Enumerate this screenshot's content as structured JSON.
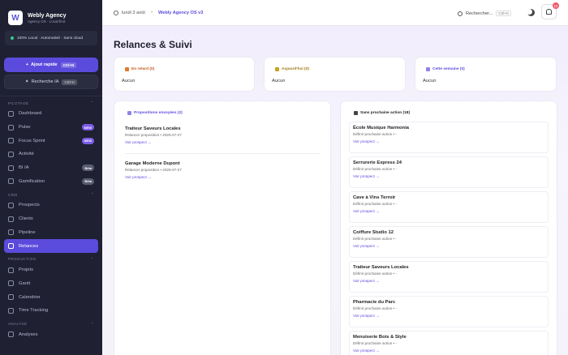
{
  "brand": {
    "name": "Webly Agency",
    "sub": "Agency OS · Local-first"
  },
  "status": {
    "text": "100% Local · Automatisé · Sans cloud",
    "color": "#3ec98c"
  },
  "actions": {
    "quick_label": "Ajout rapide",
    "quick_kbd": "Ctrl+N",
    "ai_label": "Recherche IA",
    "ai_kbd": "Ctrl+K"
  },
  "sections": {
    "pilotage": "PILOTAGE",
    "crm": "CRM",
    "production": "PRODUCTION",
    "analyse": "ANALYSE"
  },
  "nav": {
    "dashboard": "Dashboard",
    "pulse": "Pulse",
    "pulse_badge": "NEW",
    "focus": "Focus Sprint",
    "focus_badge": "NEW",
    "activite": "Activité",
    "bi": "BI IA",
    "bi_badge": "Bêta",
    "gamification": "Gamification",
    "gamification_badge": "Bêta",
    "prospects": "Prospects",
    "clients": "Clients",
    "pipeline": "Pipeline",
    "relances": "Relances",
    "projets": "Projets",
    "gantt": "Gantt",
    "calendrier": "Calendrier",
    "time": "Time Tracking",
    "analyses": "Analyses"
  },
  "topbar": {
    "date": "lundi 3 août",
    "sep": "•",
    "app": "Webly Agency OS v3",
    "search": "Rechercher...",
    "search_kbd": "Ctrl+K",
    "notif_count": "12"
  },
  "page": {
    "title": "Relances & Suivi"
  },
  "summary": [
    {
      "label": "En retard (0)",
      "value": "Aucun",
      "color": "#e07a2f"
    },
    {
      "label": "Aujourd'hui (0)",
      "value": "Aucun",
      "color": "#b8860b"
    },
    {
      "label": "Cette semaine (0)",
      "value": "Aucun",
      "color": "#6a5ce0"
    }
  ],
  "proposals": {
    "title": "Propositions envoyées (2)",
    "items": [
      {
        "name": "Traiteur Saveurs Locales",
        "sub": "Relancer proposition • 2026-07-27",
        "link": "Voir prospect →"
      },
      {
        "name": "Garage Moderne Dupont",
        "sub": "Relancer proposition • 2026-07-27",
        "link": "Voir prospect →"
      }
    ]
  },
  "noaction": {
    "title": "Sans prochaine action (18)",
    "items": [
      {
        "name": "École Musique Harmonia",
        "sub": "Définir prochaine action • -",
        "link": "Voir prospect →"
      },
      {
        "name": "Serrurerie Express 24",
        "sub": "Définir prochaine action • -",
        "link": "Voir prospect →"
      },
      {
        "name": "Cave à Vins Terroir",
        "sub": "Définir prochaine action • -",
        "link": "Voir prospect →"
      },
      {
        "name": "Coiffure Studio 12",
        "sub": "Définir prochaine action • -",
        "link": "Voir prospect →"
      },
      {
        "name": "Traiteur Saveurs Locales",
        "sub": "Définir prochaine action • -",
        "link": "Voir prospect →"
      },
      {
        "name": "Pharmacie du Parc",
        "sub": "Définir prochaine action • -",
        "link": "Voir prospect →"
      },
      {
        "name": "Menuiserie Bois & Style",
        "sub": "Définir prochaine action • -",
        "link": "Voir prospect →"
      }
    ]
  }
}
